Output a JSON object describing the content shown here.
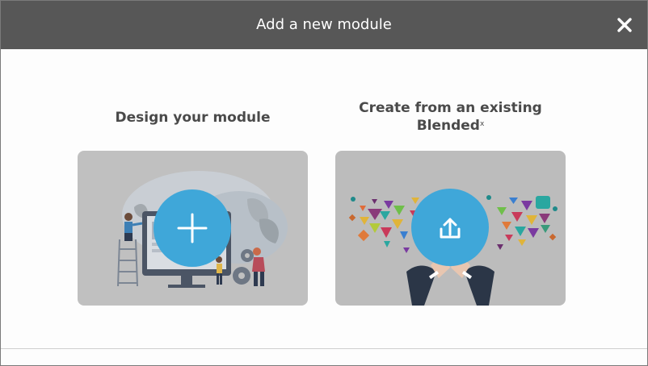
{
  "header": {
    "title": "Add a new module",
    "close_icon": "close-icon"
  },
  "options": [
    {
      "title": "Design your module",
      "icon": "plus-icon",
      "accent": "#3fa7d9"
    },
    {
      "title": "Create from an existing Blended",
      "title_mark": "x",
      "icon": "upload-icon",
      "accent": "#3fa7d9"
    }
  ],
  "colors": {
    "header_bg": "#575757",
    "card_bg": "#c0c0c0",
    "accent": "#3fa7d9"
  }
}
